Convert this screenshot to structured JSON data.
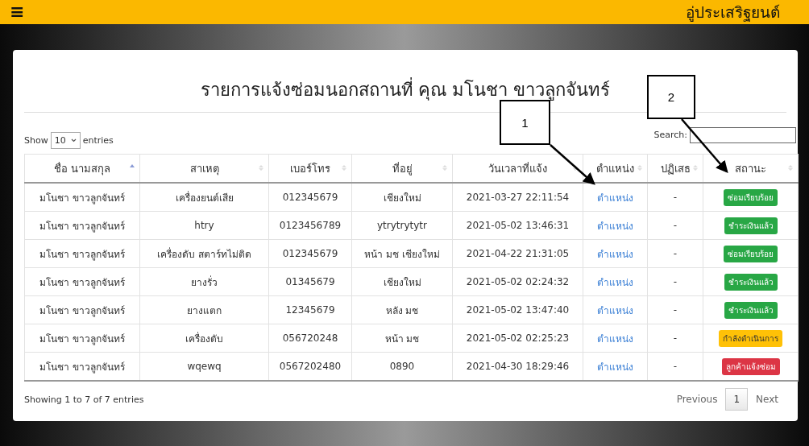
{
  "header": {
    "menu_icon": "≡",
    "brand": "อู่ประเสริฐยนต์"
  },
  "title": "รายการแจ้งซ่อมนอกสถานที่ คุณ มโนชา ขาวลูกจันทร์",
  "length_control": {
    "before": "Show",
    "value": "10",
    "after": "entries"
  },
  "search": {
    "label": "Search:"
  },
  "table": {
    "columns": [
      {
        "label": "ชื่อ นามสกุล",
        "sorted": true
      },
      {
        "label": "สาเหตุ",
        "sorted": false
      },
      {
        "label": "เบอร์โทร",
        "sorted": false
      },
      {
        "label": "ที่อยู่",
        "sorted": false
      },
      {
        "label": "วันเวลาที่แจ้ง",
        "sorted": false
      },
      {
        "label": "ตำแหน่ง",
        "sorted": false
      },
      {
        "label": "ปฏิเสธ",
        "sorted": false
      },
      {
        "label": "สถานะ",
        "sorted": false
      }
    ],
    "rows": [
      {
        "name": "มโนชา ขาวลูกจันทร์",
        "cause": "เครื่องยนต์เสีย",
        "phone": "012345679",
        "address": "เชียงใหม่",
        "datetime": "2021-03-27 22:11:54",
        "location": "ตำแหน่ง",
        "reject": "-",
        "status": {
          "label": "ซ่อมเรียบร้อย",
          "color": "#28a745"
        }
      },
      {
        "name": "มโนชา ขาวลูกจันทร์",
        "cause": "htry",
        "phone": "0123456789",
        "address": "ytrytrytytr",
        "datetime": "2021-05-02 13:46:31",
        "location": "ตำแหน่ง",
        "reject": "-",
        "status": {
          "label": "ชำระเงินแล้ว",
          "color": "#28a745"
        }
      },
      {
        "name": "มโนชา ขาวลูกจันทร์",
        "cause": "เครื่องดับ สตาร์ทไม่ติด",
        "phone": "012345679",
        "address": "หน้า มช เชียงใหม่",
        "datetime": "2021-04-22 21:31:05",
        "location": "ตำแหน่ง",
        "reject": "-",
        "status": {
          "label": "ซ่อมเรียบร้อย",
          "color": "#28a745"
        }
      },
      {
        "name": "มโนชา ขาวลูกจันทร์",
        "cause": "ยางรั่ว",
        "phone": "01345679",
        "address": "เชียงใหม่",
        "datetime": "2021-05-02 02:24:32",
        "location": "ตำแหน่ง",
        "reject": "-",
        "status": {
          "label": "ชำระเงินแล้ว",
          "color": "#28a745"
        }
      },
      {
        "name": "มโนชา ขาวลูกจันทร์",
        "cause": "ยางแตก",
        "phone": "12345679",
        "address": "หลัง มช",
        "datetime": "2021-05-02 13:47:40",
        "location": "ตำแหน่ง",
        "reject": "-",
        "status": {
          "label": "ชำระเงินแล้ว",
          "color": "#28a745"
        }
      },
      {
        "name": "มโนชา ขาวลูกจันทร์",
        "cause": "เครื่องดับ",
        "phone": "056720248",
        "address": "หน้า มช",
        "datetime": "2021-05-02 02:25:23",
        "location": "ตำแหน่ง",
        "reject": "-",
        "status": {
          "label": "กำลังดำเนินการ",
          "color": "#ffc107"
        }
      },
      {
        "name": "มโนชา ขาวลูกจันทร์",
        "cause": "wqewq",
        "phone": "0567202480",
        "address": "0890",
        "datetime": "2021-04-30 18:29:46",
        "location": "ตำแหน่ง",
        "reject": "-",
        "status": {
          "label": "ลูกค้าแจ้งซ่อม",
          "color": "#dc3545"
        }
      }
    ]
  },
  "info": "Showing 1 to 7 of 7 entries",
  "pagination": [
    {
      "label": "Previous",
      "selected": false
    },
    {
      "label": "1",
      "selected": true
    },
    {
      "label": "Next",
      "selected": false
    }
  ],
  "callouts": [
    "1",
    "2"
  ]
}
